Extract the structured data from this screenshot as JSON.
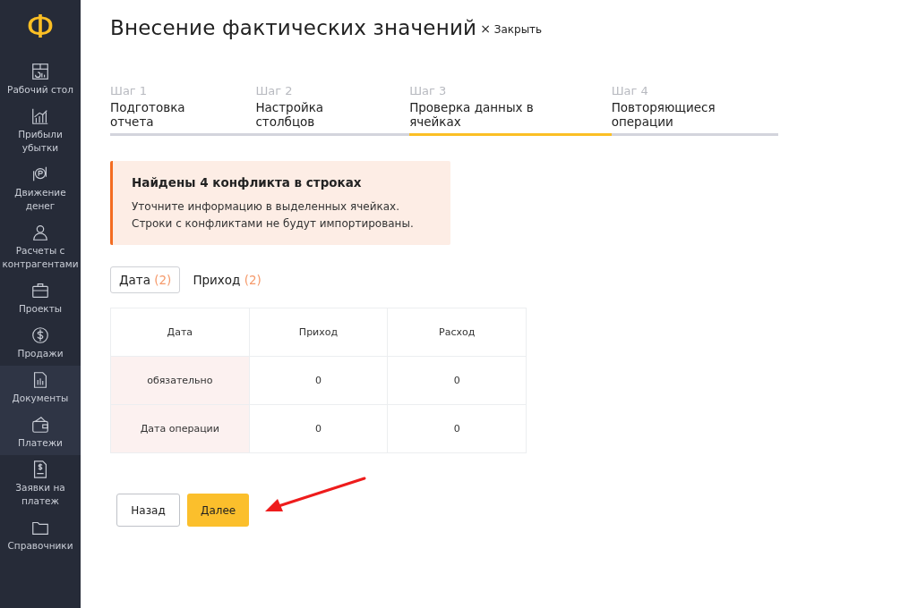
{
  "sidebar": {
    "logo": "Ф",
    "items": [
      {
        "label": "Рабочий стол",
        "selected": false
      },
      {
        "label": "Прибыли убытки",
        "selected": false
      },
      {
        "label": "Движение денег",
        "selected": false
      },
      {
        "label": "Расчеты с контрагентами",
        "selected": false
      },
      {
        "label": "Проекты",
        "selected": false
      },
      {
        "label": "Продажи",
        "selected": false
      },
      {
        "label": "Документы",
        "selected": true
      },
      {
        "label": "Платежи",
        "selected": true
      },
      {
        "label": "Заявки на платеж",
        "selected": false
      },
      {
        "label": "Справочники",
        "selected": false
      }
    ]
  },
  "header": {
    "title": "Внесение фактических значений",
    "close_icon": "×",
    "close": "Закрыть"
  },
  "steps": [
    {
      "number": "Шаг 1",
      "label": "Подготовка отчета",
      "selected": false
    },
    {
      "number": "Шаг 2",
      "label": "Настройка столбцов",
      "selected": false
    },
    {
      "number": "Шаг 3",
      "label": "Проверка данных в ячейках",
      "selected": true
    },
    {
      "number": "Шаг 4",
      "label": "Повторяющиеся операции",
      "selected": false
    }
  ],
  "alert": {
    "title": "Найдены 4 конфликта в строках",
    "lines": [
      "Уточните информацию в выделенных ячейках.",
      "Строки с конфликтами не будут импортированы."
    ]
  },
  "filter_tabs": [
    {
      "label": "Дата",
      "count": "(2)",
      "selected": true
    },
    {
      "label": "Приход",
      "count": "(2)",
      "selected": false
    }
  ],
  "table": {
    "columns": [
      "Дата",
      "Приход",
      "Расход"
    ],
    "rows": [
      [
        {
          "text": "обязательно",
          "conflict": true
        },
        {
          "text": "0",
          "conflict": false
        },
        {
          "text": "0",
          "conflict": false
        }
      ],
      [
        {
          "text": "Дата операции",
          "conflict": true
        },
        {
          "text": "0",
          "conflict": false
        },
        {
          "text": "0",
          "conflict": false
        }
      ]
    ]
  },
  "buttons": {
    "back": "Назад",
    "next": "Далее"
  }
}
